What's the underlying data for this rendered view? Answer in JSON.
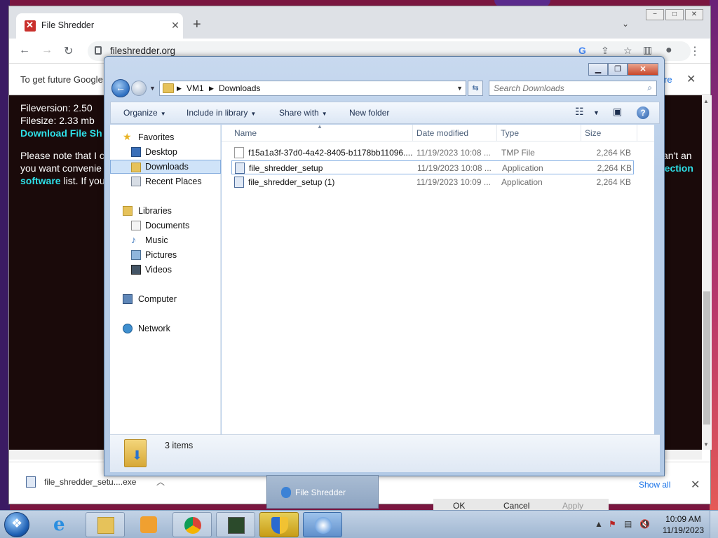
{
  "browser": {
    "tab_title": "File Shredder",
    "new_tab_symbol": "+",
    "url": "fileshredder.org",
    "infobar_text": "To get future Google",
    "infobar_link": "re",
    "window_controls": [
      "−",
      "□",
      "✕"
    ]
  },
  "webpage": {
    "line1": "Fileversion: 2.50",
    "line2": "Filesize: 2.33 mb",
    "download_link": "Download File Sh",
    "note_line1": "Please note that I c",
    "note_line2": "you want convenie",
    "software_link": "software",
    "note_line3": " list. If you",
    "right_fragment1": "an't an",
    "right_fragment2": "tection"
  },
  "download_shelf": {
    "filename": "file_shredder_setu....exe",
    "show_all": "Show all"
  },
  "ghost_dialog": {
    "ok": "OK",
    "cancel": "Cancel",
    "apply": "Apply"
  },
  "explorer": {
    "breadcrumb": [
      "VM1",
      "Downloads"
    ],
    "search_placeholder": "Search Downloads",
    "commands": {
      "organize": "Organize",
      "include_in_library": "Include in library",
      "share_with": "Share with",
      "new_folder": "New folder"
    },
    "nav": {
      "favorites": "Favorites",
      "desktop": "Desktop",
      "downloads": "Downloads",
      "recent_places": "Recent Places",
      "libraries": "Libraries",
      "documents": "Documents",
      "music": "Music",
      "pictures": "Pictures",
      "videos": "Videos",
      "computer": "Computer",
      "network": "Network"
    },
    "columns": [
      "Name",
      "Date modified",
      "Type",
      "Size"
    ],
    "files": [
      {
        "name": "f15a1a3f-37d0-4a42-8405-b1178bb11096....",
        "date": "11/19/2023 10:08 ...",
        "type": "TMP File",
        "size": "2,264 KB"
      },
      {
        "name": "file_shredder_setup",
        "date": "11/19/2023 10:08 ...",
        "type": "Application",
        "size": "2,264 KB"
      },
      {
        "name": "file_shredder_setup (1)",
        "date": "11/19/2023 10:09 ...",
        "type": "Application",
        "size": "2,264 KB"
      }
    ],
    "item_count": "3 items"
  },
  "taskbar": {
    "thumbnail_title": "File Shredder",
    "time": "10:09 AM",
    "date": "11/19/2023"
  }
}
